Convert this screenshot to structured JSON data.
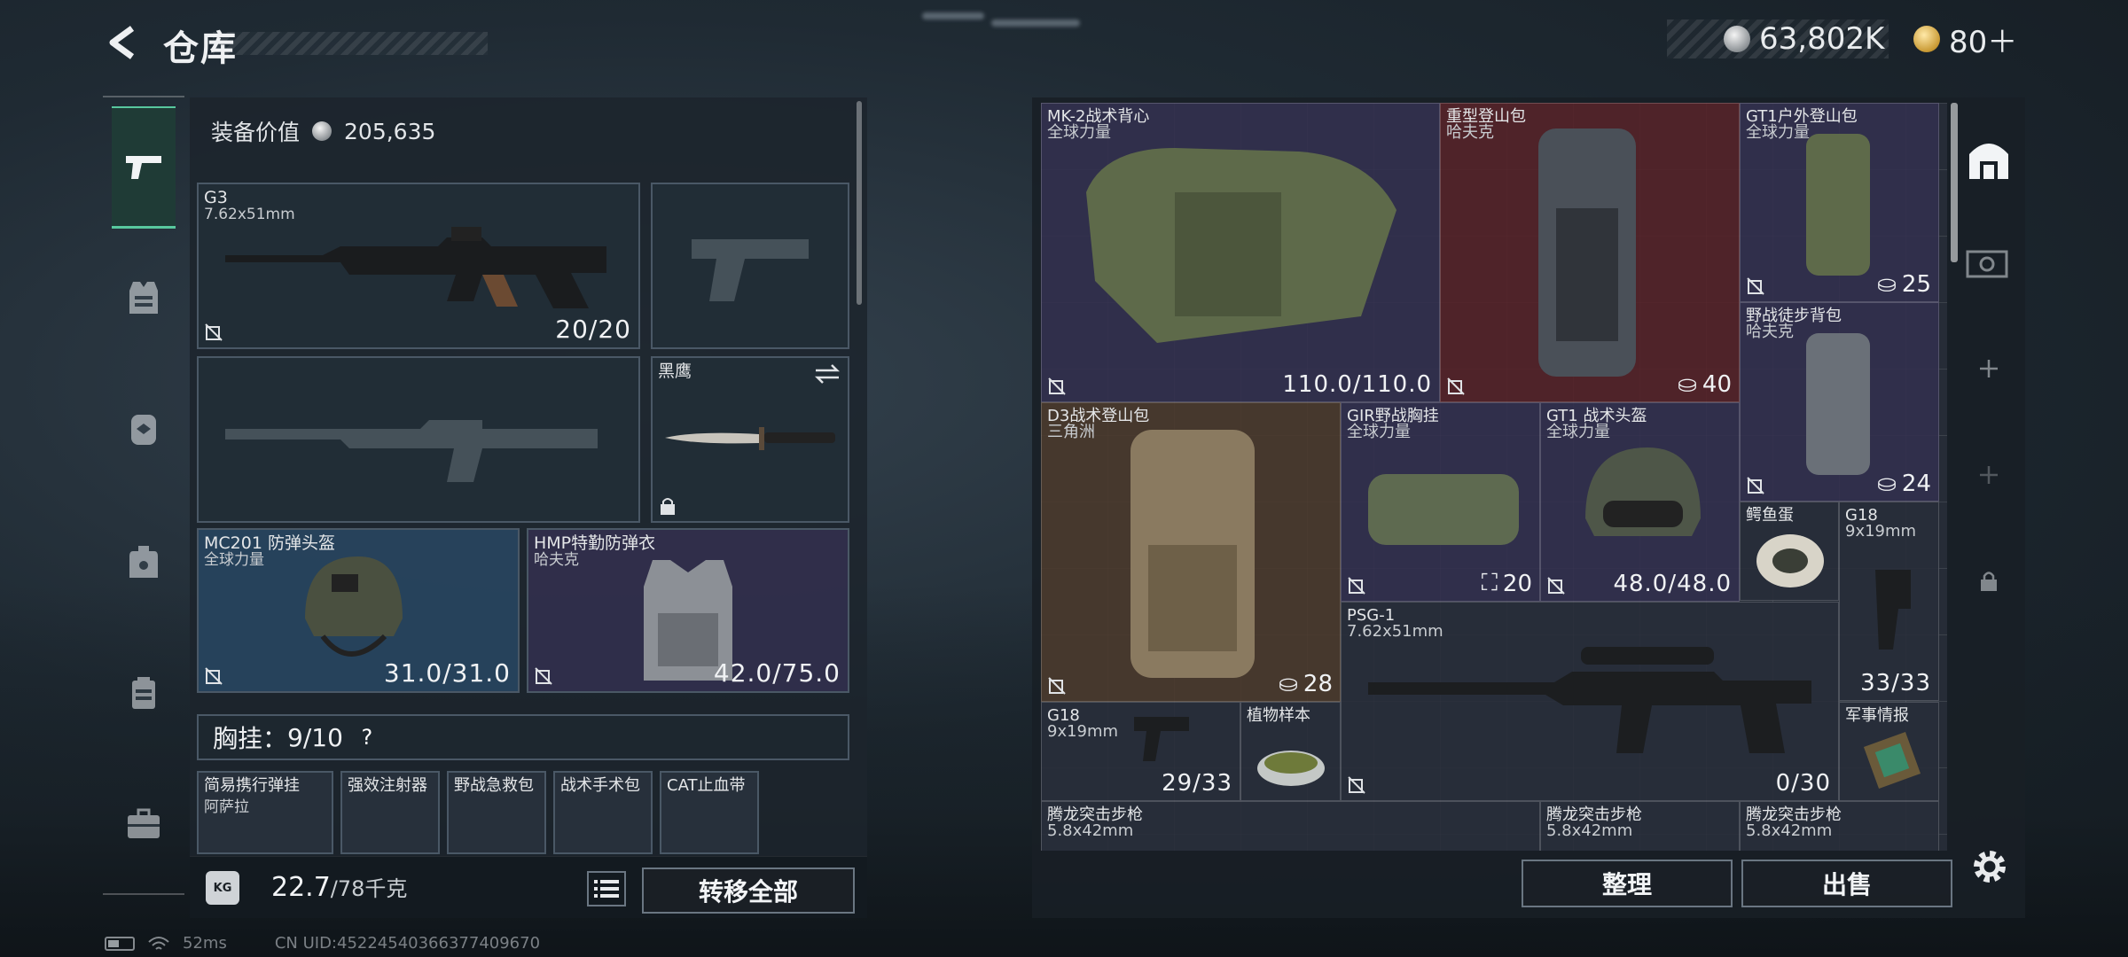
{
  "header": {
    "title": "仓库",
    "currency_silver": "63,802K",
    "currency_gold": "80＋"
  },
  "left_panel": {
    "equip_value_label": "装备价值",
    "equip_value": "205,635",
    "primary_weapon": {
      "name": "G3",
      "caliber": "7.62x51mm",
      "ammo": "20/20"
    },
    "melee": {
      "name": "黑鹰"
    },
    "helmet": {
      "name": "MC201 防弹头盔",
      "source": "全球力量",
      "durability": "31.0/31.0"
    },
    "armor": {
      "name": "HMP特勤防弹衣",
      "source": "哈夫克",
      "durability": "42.0/75.0"
    },
    "chest_rig": {
      "label": "胸挂：",
      "value": "9/10",
      "help": "?"
    },
    "chest_items": [
      {
        "name": "简易携行弹挂",
        "sub": "阿萨拉"
      },
      {
        "name": "强效注射器",
        "sub": ""
      },
      {
        "name": "野战急救包",
        "sub": ""
      },
      {
        "name": "战术手术包",
        "sub": ""
      },
      {
        "name": "CAT止血带",
        "sub": ""
      }
    ],
    "weight_icon": "KG",
    "weight_current": "22.7",
    "weight_max": "/78千克",
    "transfer_all": "转移全部"
  },
  "stash": {
    "items": [
      {
        "name": "MK-2战术背心",
        "sub": "全球力量",
        "value": "110.0/110.0"
      },
      {
        "name": "重型登山包",
        "sub": "哈夫克",
        "value": "40"
      },
      {
        "name": "GT1户外登山包",
        "sub": "全球力量",
        "value": "25"
      },
      {
        "name": "野战徒步背包",
        "sub": "哈夫克",
        "value": "24"
      },
      {
        "name": "D3战术登山包",
        "sub": "三角洲",
        "value": "28"
      },
      {
        "name": "GIR野战胸挂",
        "sub": "全球力量",
        "value": "20"
      },
      {
        "name": "GT1 战术头盔",
        "sub": "全球力量",
        "value": "48.0/48.0"
      },
      {
        "name": "鳄鱼蛋",
        "sub": ""
      },
      {
        "name": "G18",
        "sub": "9x19mm",
        "value": "33/33"
      },
      {
        "name": "PSG-1",
        "sub": "7.62x51mm",
        "value": "0/30"
      },
      {
        "name": "G18",
        "sub": "9x19mm",
        "value": "29/33"
      },
      {
        "name": "植物样本",
        "sub": ""
      },
      {
        "name": "军事情报",
        "sub": ""
      },
      {
        "name": "腾龙突击步枪",
        "sub": "5.8x42mm"
      },
      {
        "name": "腾龙突击步枪",
        "sub": "5.8x42mm"
      },
      {
        "name": "腾龙突击步枪",
        "sub": "5.8x42mm"
      }
    ],
    "sort_button": "整理",
    "sell_button": "出售"
  },
  "status": {
    "ping": "52ms",
    "uid": "CN UID:45224540366377409670"
  }
}
